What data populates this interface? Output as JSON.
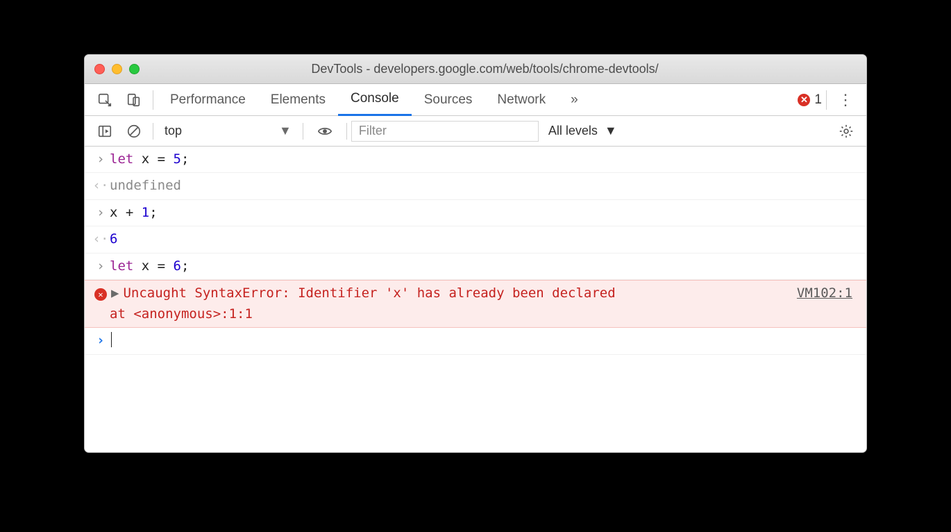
{
  "titlebar": {
    "title": "DevTools - developers.google.com/web/tools/chrome-devtools/"
  },
  "tabs": {
    "items": [
      "Performance",
      "Elements",
      "Console",
      "Sources",
      "Network"
    ],
    "active": "Console",
    "overflow": "»",
    "error_count": "1"
  },
  "subbar": {
    "context": "top",
    "filter_placeholder": "Filter",
    "levels": "All levels"
  },
  "console": {
    "rows": [
      {
        "type": "in",
        "tokens": [
          [
            "let",
            "let "
          ],
          [
            "var",
            "x"
          ],
          [
            "op",
            " = "
          ],
          [
            "num",
            "5"
          ],
          [
            "op",
            ";"
          ]
        ]
      },
      {
        "type": "out",
        "tokens": [
          [
            "undef",
            "undefined"
          ]
        ]
      },
      {
        "type": "in",
        "tokens": [
          [
            "var",
            "x"
          ],
          [
            "op",
            " + "
          ],
          [
            "num",
            "1"
          ],
          [
            "op",
            ";"
          ]
        ]
      },
      {
        "type": "out",
        "tokens": [
          [
            "ret",
            "6"
          ]
        ]
      },
      {
        "type": "in",
        "tokens": [
          [
            "let",
            "let "
          ],
          [
            "var",
            "x"
          ],
          [
            "op",
            " = "
          ],
          [
            "num",
            "6"
          ],
          [
            "op",
            ";"
          ]
        ]
      }
    ],
    "error": {
      "message": "Uncaught SyntaxError: Identifier 'x' has already been declared",
      "stack": "    at <anonymous>:1:1",
      "source": "VM102:1"
    }
  },
  "glyphs": {
    "in": "›",
    "out": "‹·",
    "prompt": "›",
    "triangle": "▶",
    "caret": "▼",
    "kebab": "⋮",
    "overflow": "»"
  }
}
